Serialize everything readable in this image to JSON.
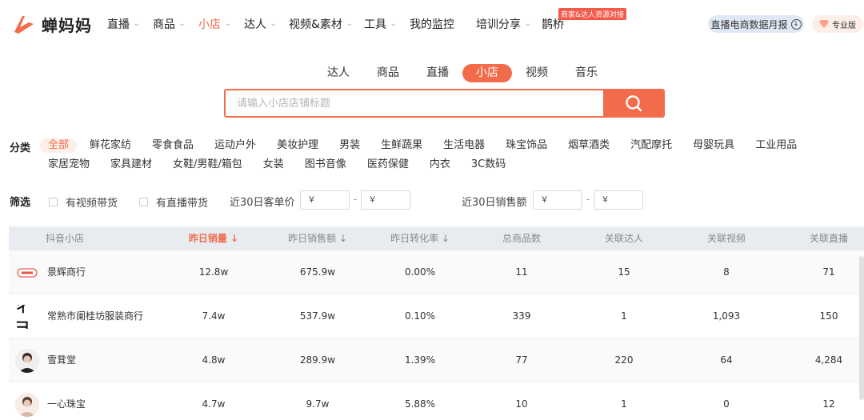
{
  "brand": {
    "name": "蝉妈妈"
  },
  "nav": {
    "items": [
      {
        "label": "直播",
        "chev": true
      },
      {
        "label": "商品",
        "chev": true
      },
      {
        "label": "小店",
        "chev": true,
        "active": true
      },
      {
        "label": "达人",
        "chev": true
      },
      {
        "label": "视频&素材",
        "chev": true
      },
      {
        "label": "工具",
        "chev": true
      },
      {
        "label": "我的监控",
        "chev": false
      },
      {
        "label": "培训分享",
        "chev": true
      },
      {
        "label": "鹊桥",
        "chev": false
      }
    ],
    "badge": "商家&达人资源对接",
    "report_label": "直播电商数据月报",
    "pro_label": "专业版"
  },
  "search": {
    "tabs": [
      "达人",
      "商品",
      "直播",
      "小店",
      "视频",
      "音乐"
    ],
    "active_tab": "小店",
    "placeholder": "请输入小店店铺标题"
  },
  "category": {
    "label": "分类",
    "row1": [
      "全部",
      "鲜花家纺",
      "零食食品",
      "运动户外",
      "美妆护理",
      "男装",
      "生鲜蔬果",
      "生活电器",
      "珠宝饰品",
      "烟草酒类",
      "汽配摩托",
      "母婴玩具",
      "工业用品"
    ],
    "row2": [
      "家居宠物",
      "家具建材",
      "女鞋/男鞋/箱包",
      "女装",
      "图书音像",
      "医药保健",
      "内衣",
      "3C数码"
    ],
    "active": "全部"
  },
  "filter": {
    "label": "筛选",
    "video_check": "有视频带货",
    "live_check": "有直播带货",
    "price_label": "近30日客单价",
    "sales_label": "近30日销售额",
    "currency": "¥",
    "dash": "-"
  },
  "table": {
    "headers": [
      "抖音小店",
      "昨日销量 ↓",
      "昨日销售额 ↓",
      "昨日转化率 ↓",
      "总商品数",
      "关联达人",
      "关联视频",
      "关联直播"
    ],
    "sorted_col": 1,
    "rows": [
      {
        "name": "景辉商行",
        "avatar": "logo-badge",
        "sales": "12.8w",
        "revenue": "675.9w",
        "cvr": "0.00%",
        "products": "11",
        "creators": "15",
        "videos": "8",
        "lives": "71"
      },
      {
        "name": "常熟市阑桂坊服装商行",
        "avatar": "text-logo",
        "sales": "7.4w",
        "revenue": "537.9w",
        "cvr": "0.10%",
        "products": "339",
        "creators": "1",
        "videos": "1,093",
        "lives": "150"
      },
      {
        "name": "雪茸堂",
        "avatar": "person-photo",
        "sales": "4.8w",
        "revenue": "289.9w",
        "cvr": "1.39%",
        "products": "77",
        "creators": "220",
        "videos": "64",
        "lives": "4,284"
      },
      {
        "name": "一心珠宝",
        "avatar": "person-photo",
        "sales": "4.7w",
        "revenue": "9.7w",
        "cvr": "5.88%",
        "products": "10",
        "creators": "1",
        "videos": "0",
        "lives": "12"
      }
    ],
    "avatar2_text": "ㄔ彐"
  },
  "colors": {
    "accent": "#f26b4a",
    "header_bg": "#e8ecf1"
  }
}
